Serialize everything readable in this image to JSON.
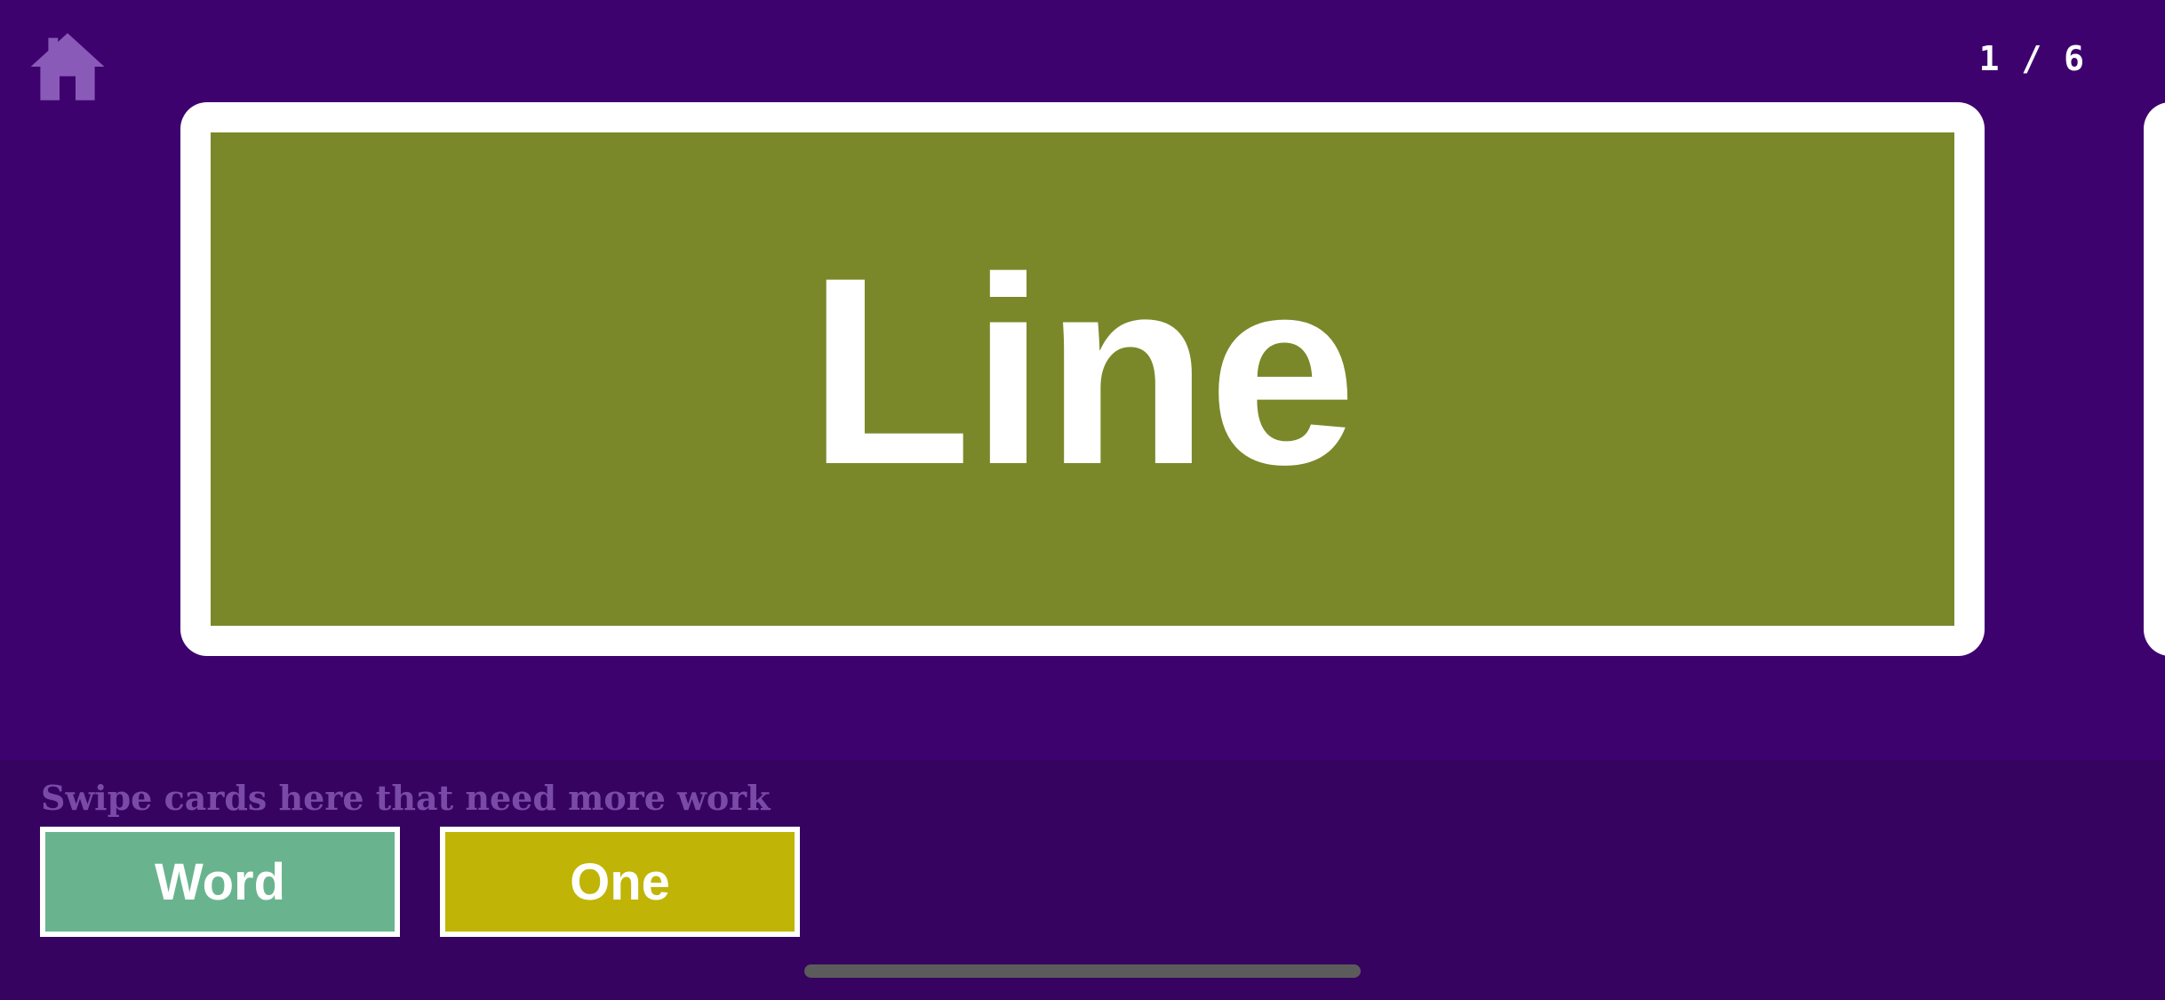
{
  "header": {
    "counter": "1 / 6"
  },
  "icons": {
    "home": "home-icon"
  },
  "current_card": {
    "word": "Line"
  },
  "tray": {
    "hint": "Swipe cards here that need more work",
    "cards": [
      {
        "label": "Word"
      },
      {
        "label": "One"
      }
    ]
  },
  "colors": {
    "background": "#3e026f",
    "tray_background": "#360361",
    "card_fill": "#7a8829",
    "word_card": "#69b48e",
    "one_card": "#c0b506",
    "home_icon": "#8a5ab8"
  }
}
